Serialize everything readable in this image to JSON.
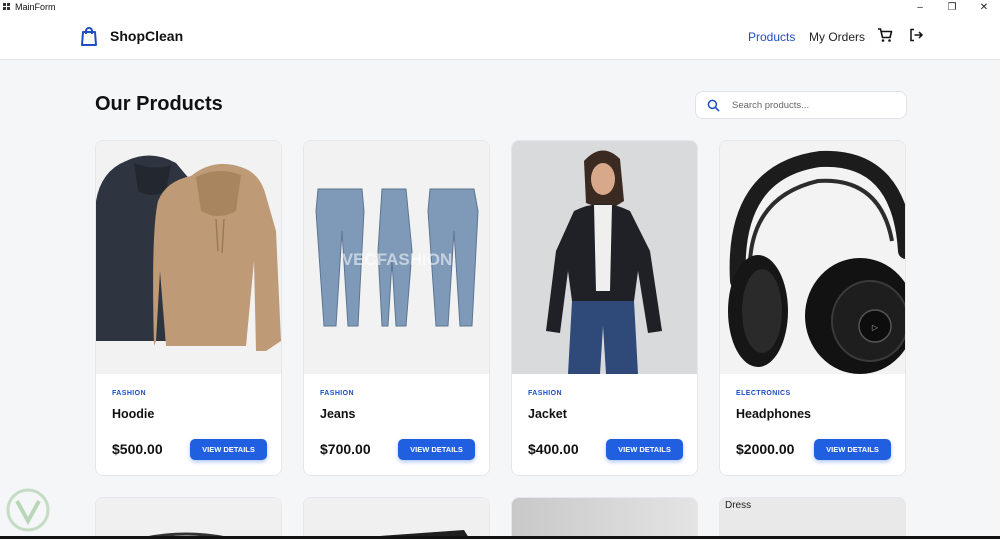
{
  "window": {
    "title": "MainForm"
  },
  "navbar": {
    "brand": "ShopClean",
    "links": [
      "Products",
      "My Orders"
    ],
    "active_link": "Products",
    "icons": [
      "cart-icon",
      "logout-icon"
    ]
  },
  "main": {
    "title": "Our Products",
    "search": {
      "placeholder": "Search products...",
      "value": ""
    }
  },
  "products": [
    {
      "category": "FASHION",
      "name": "Hoodie",
      "price": "$500.00",
      "button": "VIEW DETAILS"
    },
    {
      "category": "FASHION",
      "name": "Jeans",
      "price": "$700.00",
      "button": "VIEW DETAILS",
      "image_watermark": "VECFASHION"
    },
    {
      "category": "FASHION",
      "name": "Jacket",
      "price": "$400.00",
      "button": "VIEW DETAILS"
    },
    {
      "category": "ELECTRONICS",
      "name": "Headphones",
      "price": "$2000.00",
      "button": "VIEW DETAILS"
    }
  ],
  "second_row": [
    {
      "alt": ""
    },
    {
      "alt": ""
    },
    {
      "alt": ""
    },
    {
      "alt": "Dress"
    }
  ],
  "colors": {
    "accent": "#1d4fc4",
    "button": "#1f5fe0",
    "background": "#f5f6f8"
  }
}
